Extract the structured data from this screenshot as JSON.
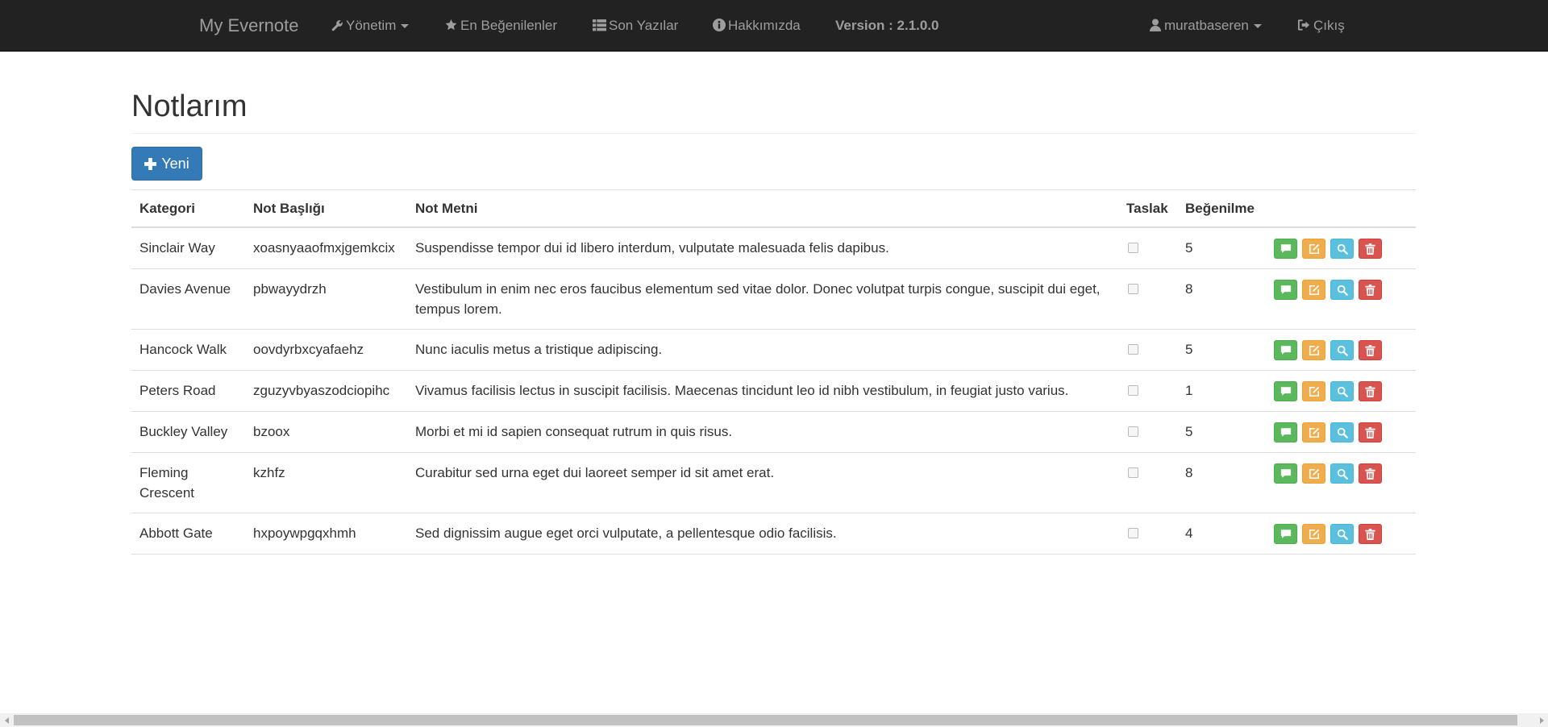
{
  "navbar": {
    "brand": "My Evernote",
    "menu": {
      "yonetim": "Yönetim",
      "favorites": "En Beğenilenler",
      "recent": "Son Yazılar",
      "about": "Hakkımızda"
    },
    "version": "Version : 2.1.0.0",
    "user": "muratbaseren",
    "logout": "Çıkış"
  },
  "page": {
    "title": "Notlarım",
    "new_button": "Yeni"
  },
  "table": {
    "headers": {
      "category": "Kategori",
      "title": "Not Başlığı",
      "text": "Not Metni",
      "draft": "Taslak",
      "likes": "Beğenilme"
    },
    "rows": [
      {
        "category": "Sinclair Way",
        "title": "xoasnyaaofmxjgemkcix",
        "text": "Suspendisse tempor dui id libero interdum, vulputate malesuada felis dapibus.",
        "draft": false,
        "likes": "5"
      },
      {
        "category": "Davies Avenue",
        "title": "pbwayydrzh",
        "text": "Vestibulum in enim nec eros faucibus elementum sed vitae dolor. Donec volutpat turpis congue, suscipit dui eget, tempus lorem.",
        "draft": false,
        "likes": "8"
      },
      {
        "category": "Hancock Walk",
        "title": "oovdyrbxcyafaehz",
        "text": "Nunc iaculis metus a tristique adipiscing.",
        "draft": false,
        "likes": "5"
      },
      {
        "category": "Peters Road",
        "title": "zguzyvbyaszodciopihc",
        "text": "Vivamus facilisis lectus in suscipit facilisis. Maecenas tincidunt leo id nibh vestibulum, in feugiat justo varius.",
        "draft": false,
        "likes": "1"
      },
      {
        "category": "Buckley Valley",
        "title": "bzoox",
        "text": "Morbi et mi id sapien consequat rutrum in quis risus.",
        "draft": false,
        "likes": "5"
      },
      {
        "category": "Fleming Crescent",
        "title": "kzhfz",
        "text": "Curabitur sed urna eget dui laoreet semper id sit amet erat.",
        "draft": false,
        "likes": "8"
      },
      {
        "category": "Abbott Gate",
        "title": "hxpoywpgqxhmh",
        "text": "Sed dignissim augue eget orci vulputate, a pellentesque odio facilisis.",
        "draft": false,
        "likes": "4"
      }
    ]
  },
  "icons": {
    "yonetim": "wrench-icon",
    "favorites": "star-icon",
    "recent": "list-icon",
    "about": "info-icon",
    "user": "user-icon",
    "logout": "logout-icon",
    "new": "plus-icon",
    "comment": "comment-icon",
    "edit": "edit-icon",
    "view": "search-icon",
    "delete": "trash-icon"
  },
  "colors": {
    "navbar_bg": "#222222",
    "primary": "#337ab7",
    "success": "#5cb85c",
    "warning": "#f0ad4e",
    "info": "#5bc0de",
    "danger": "#d9534f"
  }
}
